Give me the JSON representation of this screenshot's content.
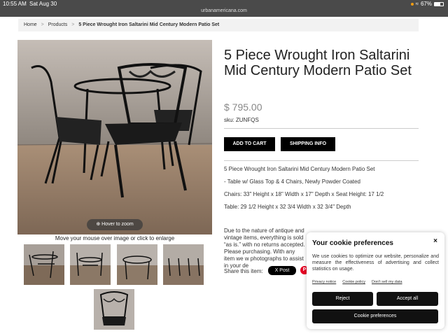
{
  "status_bar": {
    "time": "10:55 AM",
    "date": "Sat Aug 30",
    "battery": "67%",
    "battery_level": 0.67
  },
  "url": "urbanamericana.com",
  "breadcrumb": {
    "home": "Home",
    "sep": ">",
    "products": "Products",
    "current": "5 Piece Wrought Iron Saltarini Mid Century Modern Patio Set"
  },
  "gallery": {
    "zoom_label": "⊕ Hover to zoom",
    "hint": "Move your mouse over image or click to enlarge"
  },
  "product": {
    "title": "5 Piece Wrought Iron Saltarini Mid Century Modern Patio Set",
    "price": "$ 795.00",
    "sku": "sku: ZUNFQS",
    "add_to_cart": "ADD TO CART",
    "shipping_info": "SHIPPING INFO",
    "description": [
      "5 Piece Wrought Iron Saltarini Mid Century Modern Patio Set",
      "- Table w/ Glass Top & 4 Chairs, Newly Powder Coated",
      "Chairs: 33\" Height x 18\" Width x 17\" Depth x Seat Height: 17 1/2",
      "Table: 29 1/2 Height x 32 3/4 Width x 32 3/4\" Depth"
    ],
    "note": " Due to the nature of antique and vintage items, everything is sold “as is.” with no returns accepted. Please purchasing. With any item we w photographs to assist in your de"
  },
  "share": {
    "label": "Share this item:",
    "x_post": "X Post",
    "pin": "P"
  },
  "cookie": {
    "title": "Your cookie preferences",
    "close": "×",
    "body": "We use cookies to optimize our website, personalize and measure the effectiveness of advertising and collect statistics on usage.",
    "links": [
      "Privacy notice",
      "Cookie policy",
      "Don't sell my data"
    ],
    "reject": "Reject",
    "accept": "Accept all",
    "preferences": "Cookie preferences"
  }
}
